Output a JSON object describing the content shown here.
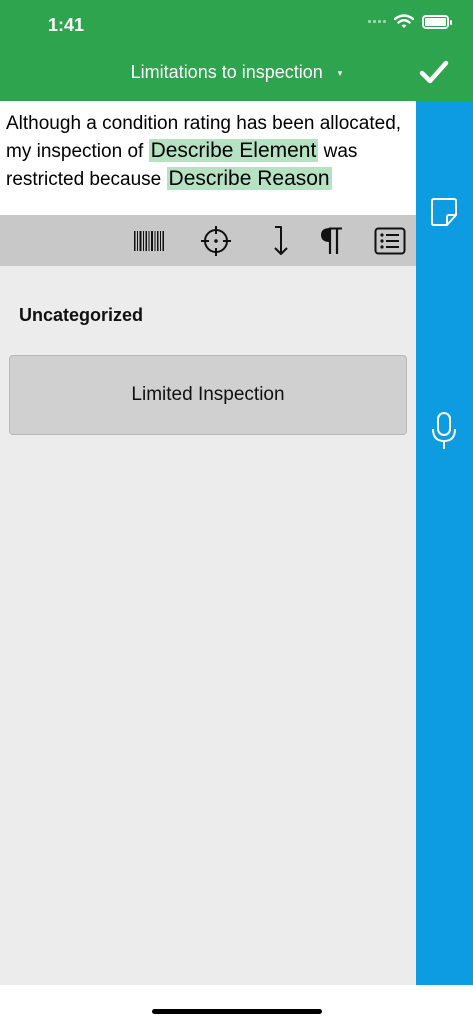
{
  "status": {
    "time": "1:41"
  },
  "header": {
    "title": "Limitations to inspection",
    "dropdown_glyph": "▾",
    "confirm_icon": "check-icon"
  },
  "editor": {
    "segments": [
      "Although a condition rating has been allocated, my inspection of ",
      "Describe Element",
      " was restricted because ",
      "Describe Reason"
    ],
    "highlight_color": "#b6e2c4"
  },
  "toolbar": {
    "tools": [
      "barcode-icon",
      "crosshair-icon",
      "arrow-down-icon",
      "paragraph-icon",
      "list-icon"
    ]
  },
  "category": {
    "label": "Uncategorized",
    "options": [
      "Limited Inspection"
    ]
  },
  "side_rail": {
    "tools": [
      "sticky-note-icon",
      "microphone-icon"
    ]
  },
  "colors": {
    "header": "#2ea44f",
    "rail": "#0d9be2",
    "toolbar": "#c8c8c8",
    "content": "#ececec"
  }
}
